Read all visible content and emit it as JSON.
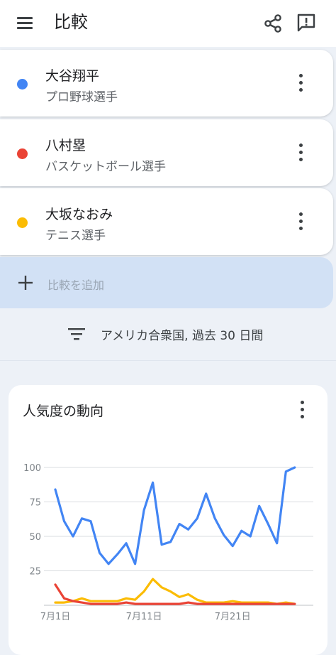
{
  "header": {
    "title": "比較",
    "menu_icon": "menu-icon",
    "share_icon": "share-icon",
    "feedback_icon": "feedback-icon"
  },
  "terms": [
    {
      "name": "大谷翔平",
      "category": "プロ野球選手",
      "color": "#4285f4"
    },
    {
      "name": "八村塁",
      "category": "バスケットボール選手",
      "color": "#ea4335"
    },
    {
      "name": "大坂なおみ",
      "category": "テニス選手",
      "color": "#fbbc04"
    }
  ],
  "add_compare": {
    "label": "比較を追加"
  },
  "filter": {
    "label": "アメリカ合衆国, 過去 30 日間"
  },
  "chart_section": {
    "title": "人気度の動向"
  },
  "chart_data": {
    "type": "line",
    "x": [
      "7月1日",
      "7月2日",
      "7月3日",
      "7月4日",
      "7月5日",
      "7月6日",
      "7月7日",
      "7月8日",
      "7月9日",
      "7月10日",
      "7月11日",
      "7月12日",
      "7月13日",
      "7月14日",
      "7月15日",
      "7月16日",
      "7月17日",
      "7月18日",
      "7月19日",
      "7月20日",
      "7月21日",
      "7月22日",
      "7月23日",
      "7月24日",
      "7月25日",
      "7月26日",
      "7月27日",
      "7月28日",
      "7月29日",
      "7月30日"
    ],
    "x_tick_labels": [
      "7月1日",
      "7月11日",
      "7月21日"
    ],
    "y_tick_labels": [
      "100",
      "75",
      "50",
      "25"
    ],
    "ylim": [
      0,
      100
    ],
    "series": [
      {
        "name": "大谷翔平",
        "color": "#4285f4",
        "values": [
          84,
          61,
          50,
          63,
          61,
          38,
          30,
          37,
          45,
          30,
          69,
          89,
          44,
          46,
          59,
          55,
          63,
          81,
          63,
          51,
          43,
          54,
          50,
          72,
          59,
          45,
          97,
          100,
          null,
          null
        ]
      },
      {
        "name": "八村塁",
        "color": "#ea4335",
        "values": [
          15,
          5,
          3,
          2,
          1,
          1,
          1,
          1,
          2,
          1,
          1,
          1,
          1,
          1,
          1,
          2,
          1,
          1,
          1,
          1,
          1,
          1,
          1,
          1,
          1,
          1,
          1,
          1,
          null,
          null
        ]
      },
      {
        "name": "大坂なおみ",
        "color": "#fbbc04",
        "values": [
          2,
          2,
          3,
          5,
          3,
          3,
          3,
          3,
          5,
          4,
          10,
          19,
          13,
          10,
          6,
          8,
          4,
          2,
          2,
          2,
          3,
          2,
          2,
          2,
          2,
          1,
          2,
          1,
          null,
          null
        ]
      }
    ]
  }
}
